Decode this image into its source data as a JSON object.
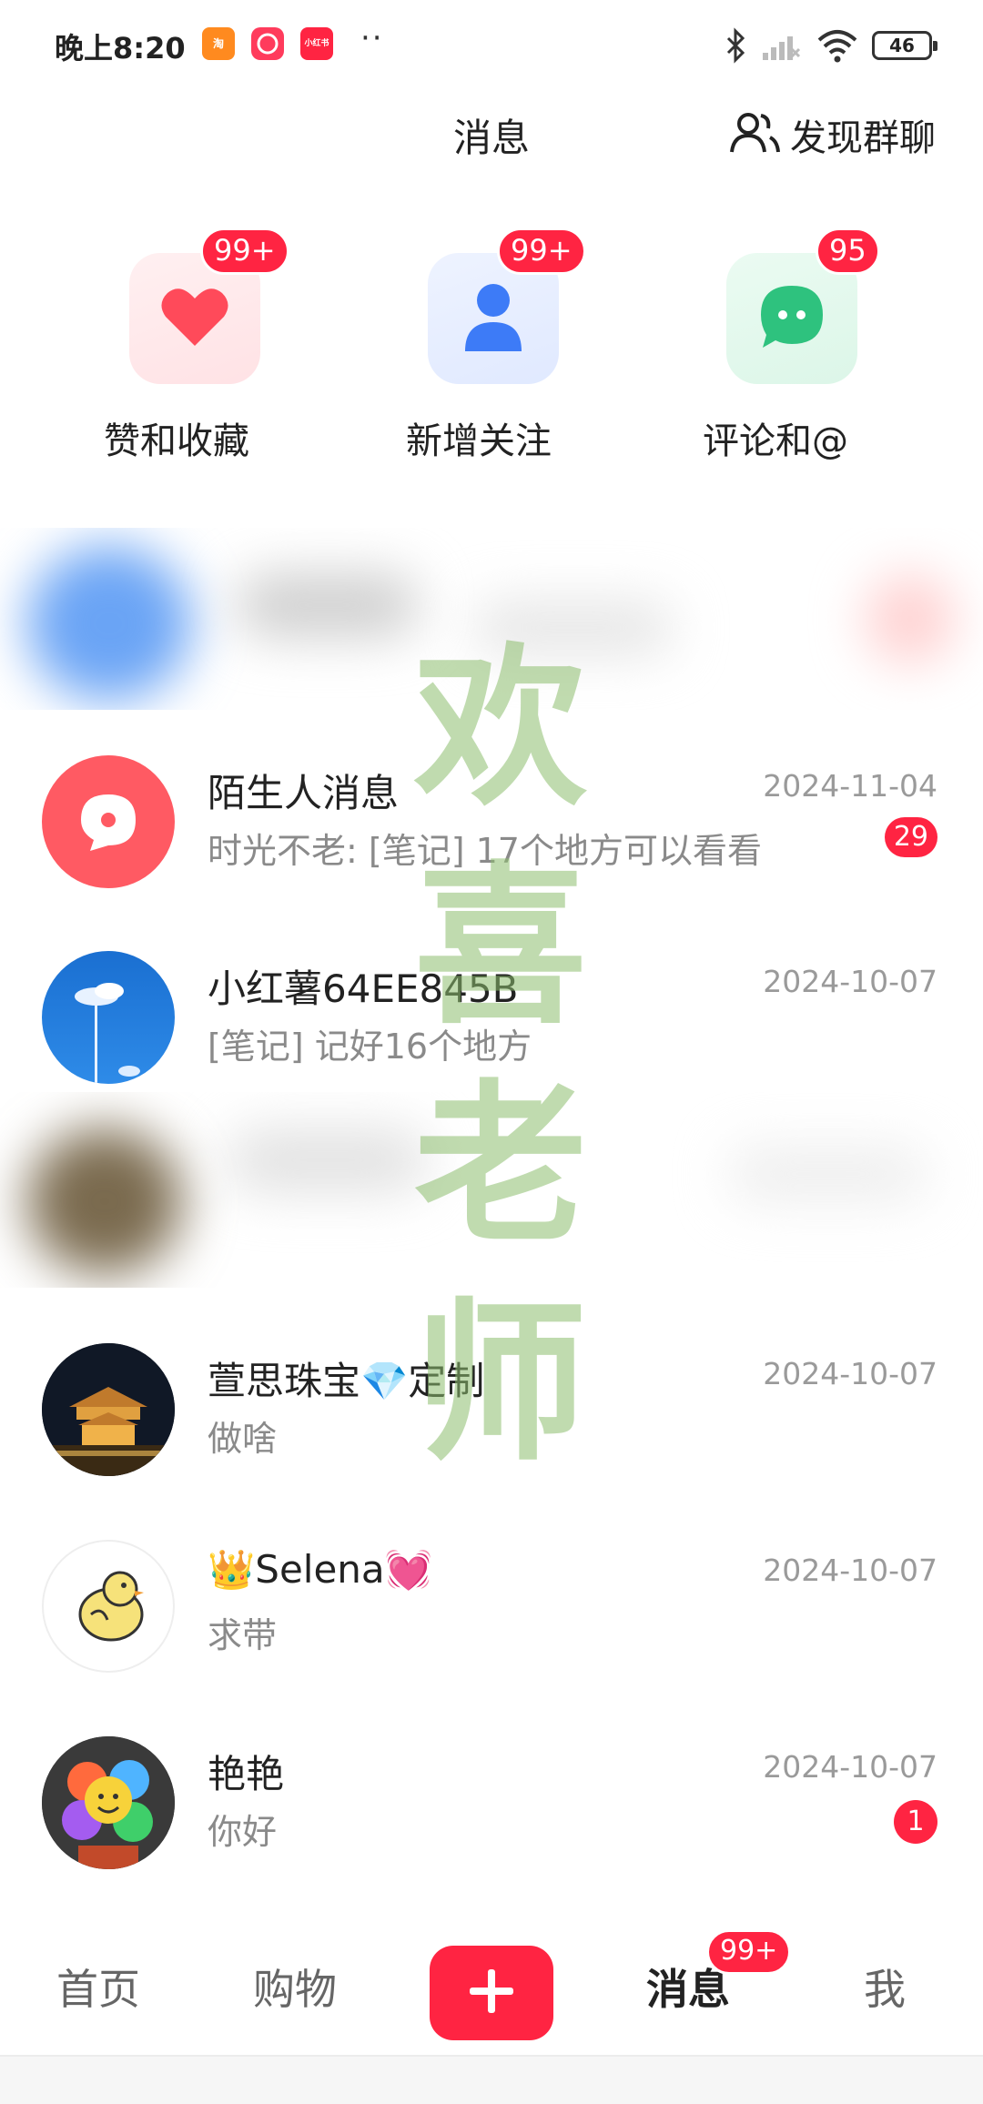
{
  "status_bar": {
    "time": "晚上8:20",
    "dots": "··",
    "battery": "46"
  },
  "header": {
    "title": "消息",
    "discover_group": "发现群聊"
  },
  "shortcuts": [
    {
      "label": "赞和收藏",
      "badge": "99+",
      "icon": "heart-icon",
      "color": "#ff4a5a"
    },
    {
      "label": "新增关注",
      "badge": "99+",
      "icon": "person-icon",
      "color": "#3d7bf7"
    },
    {
      "label": "评论和@",
      "badge": "95",
      "icon": "chat-bubble-icon",
      "color": "#2ec27e"
    }
  ],
  "messages": [
    {
      "name": "陌生人消息",
      "preview": "时光不老: [笔记] 17个地方可以看看",
      "time": "2024-11-04",
      "count": "29",
      "avatar": "stranger-message-icon"
    },
    {
      "name": "小红薯64EE845B",
      "preview": "[笔记] 记好16个地方",
      "time": "2024-10-07",
      "count": "",
      "avatar": "sky-photo-avatar"
    },
    {
      "name": "萱思珠宝💎定制",
      "preview": "做啥",
      "time": "2024-10-07",
      "count": "",
      "avatar": "palace-photo-avatar"
    },
    {
      "name": "👑Selena💓",
      "preview": "求带",
      "time": "2024-10-07",
      "count": "",
      "avatar": "chick-avatar"
    },
    {
      "name": "艳艳",
      "preview": "你好",
      "time": "2024-10-07",
      "count": "1",
      "avatar": "flower-avatar"
    }
  ],
  "watermark": [
    "欢",
    "喜",
    "老",
    "师"
  ],
  "bottom_nav": {
    "home": "首页",
    "shop": "购物",
    "messages": "消息",
    "messages_badge": "99+",
    "me": "我"
  },
  "colors": {
    "accent": "#ff2442",
    "text_primary": "#222222",
    "text_secondary": "#8a8a8a"
  }
}
